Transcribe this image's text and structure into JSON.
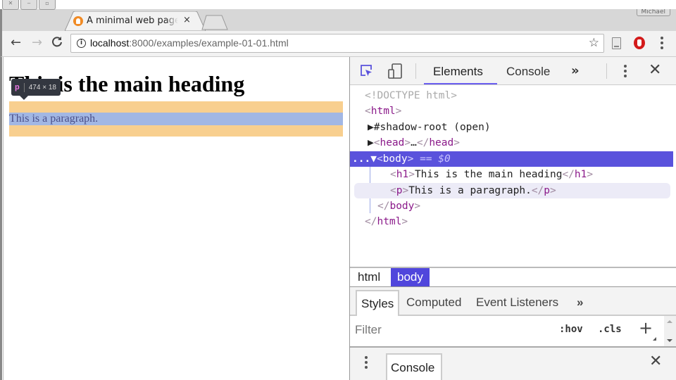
{
  "window": {
    "profile_name": "Michael",
    "controls": [
      "close",
      "minimize",
      "maximize"
    ]
  },
  "tab": {
    "title": "A minimal web page",
    "favicon": "flame-logo-icon",
    "close_label": "×"
  },
  "toolbar": {
    "back_icon": "←",
    "forward_icon": "→",
    "reload_icon": "C",
    "info_icon": "i",
    "url_host": "localhost",
    "url_rest": ":8000/examples/example-01-01.html",
    "star_icon": "☆"
  },
  "page": {
    "heading": "This is the main heading",
    "paragraph": "This is a paragraph.",
    "inspect_tooltip": {
      "tag": "p",
      "size": "474 × 18"
    },
    "colors": {
      "margin_highlight": "#f8cf8f",
      "content_highlight": "#a2b7e4"
    }
  },
  "devtools": {
    "tabs": [
      {
        "label": "Elements",
        "active": true
      },
      {
        "label": "Console",
        "active": false
      }
    ],
    "more_tabs": "»",
    "close_icon": "✕",
    "accent_color": "#5a52dc",
    "dom": {
      "doctype": "<!DOCTYPE html>",
      "html_open": "html",
      "shadow_root": "#shadow-root (open)",
      "head_tag": "head",
      "head_ellipsis": "…",
      "body_tag": "body",
      "body_eq": "== $0",
      "ellipsis_prefix": "...",
      "h1_tag": "h1",
      "h1_text": "This is the main heading",
      "p_tag": "p",
      "p_text": "This is a paragraph.",
      "body_close": "body",
      "html_close": "html"
    },
    "breadcrumbs": [
      {
        "label": "html",
        "active": false
      },
      {
        "label": "body",
        "active": true
      }
    ],
    "style_tabs": [
      {
        "label": "Styles",
        "active": true
      },
      {
        "label": "Computed",
        "active": false
      },
      {
        "label": "Event Listeners",
        "active": false
      }
    ],
    "style_more": "»",
    "filter_placeholder": "Filter",
    "hov_label": ":hov",
    "cls_label": ".cls",
    "add_rule": "+",
    "drawer": {
      "tab_label": "Console",
      "close_icon": "✕"
    }
  }
}
